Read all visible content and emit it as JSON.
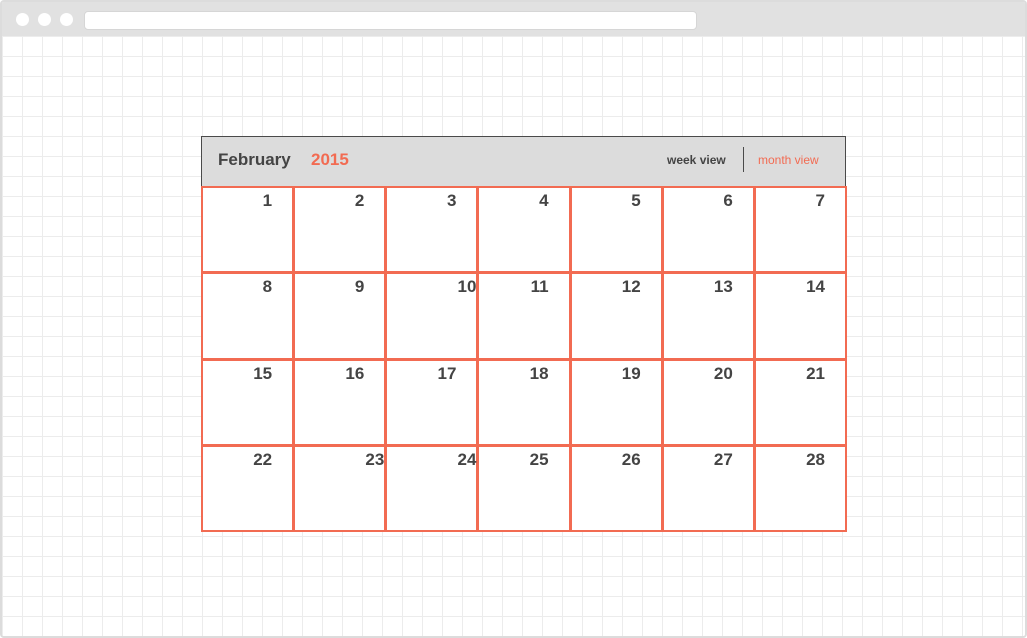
{
  "browser": {
    "address": ""
  },
  "calendar": {
    "month": "February",
    "year": "2015",
    "views": {
      "week": "week view",
      "month": "month view",
      "active": "month"
    },
    "days": [
      "1",
      "2",
      "3",
      "4",
      "5",
      "6",
      "7",
      "8",
      "9",
      "10",
      "11",
      "12",
      "13",
      "14",
      "15",
      "16",
      "17",
      "18",
      "19",
      "20",
      "21",
      "22",
      "23",
      "24",
      "25",
      "26",
      "27",
      "28"
    ]
  },
  "colors": {
    "accent": "#f26b52",
    "header_bg": "#dcdcdc",
    "text": "#444444"
  }
}
